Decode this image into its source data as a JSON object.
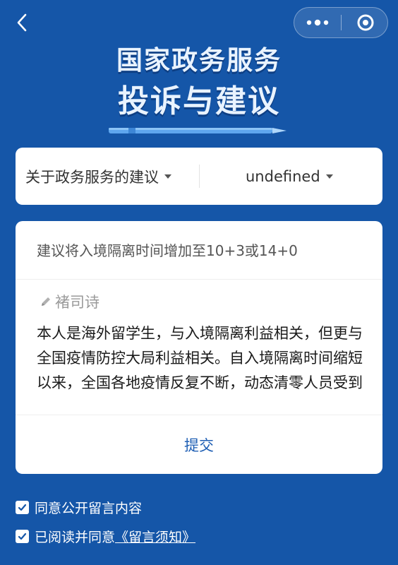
{
  "nav": {
    "back_icon": "chevron-left-icon",
    "more_icon": "three-dots-icon",
    "close_icon": "target-circle-icon"
  },
  "hero": {
    "line1": "国家政务服务",
    "line2": "投诉与建议"
  },
  "category": {
    "primary": "关于政务服务的建议",
    "secondary": "undefined"
  },
  "message": {
    "title": "建议将入境隔离时间增加至10+3或14+0",
    "author": "褚司诗",
    "body": "本人是海外留学生，与入境隔离利益相关，但更与全国疫情防控大局利益相关。自入境隔离时间缩短以来，全国各地疫情反复不断，动态清零人员受到严重打击，现正奋行",
    "submit_label": "提交"
  },
  "agreements": {
    "public_label": "同意公开留言内容",
    "read_prefix": "已阅读并同意",
    "notice_link": "《留言须知》"
  },
  "colors": {
    "background": "#1556a8",
    "accent": "#1f5fb4"
  }
}
